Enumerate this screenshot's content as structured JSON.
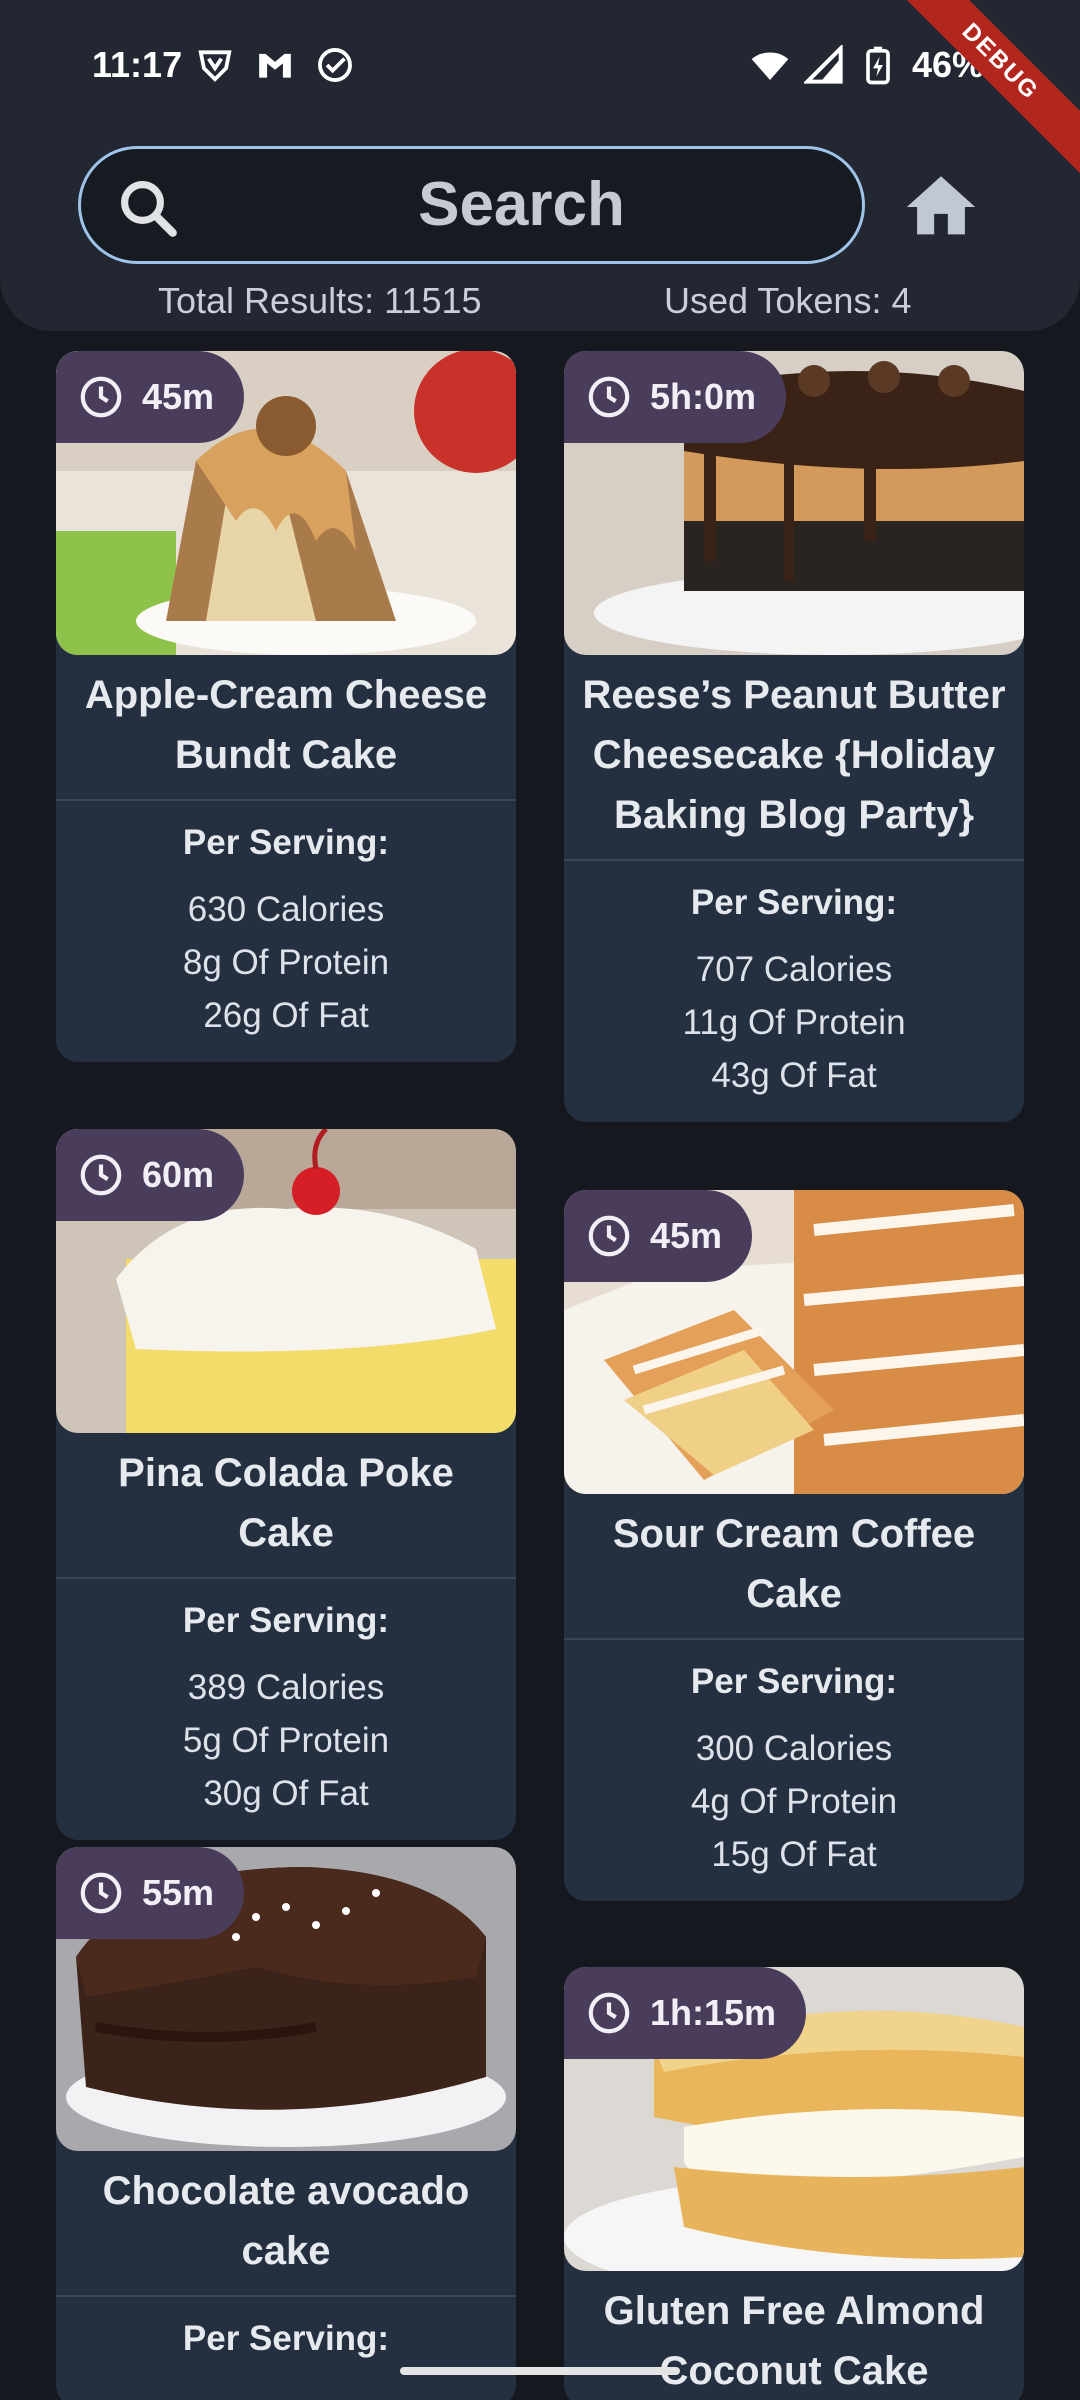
{
  "status_bar": {
    "time": "11:17",
    "battery": "46%",
    "debug_label": "DEBUG"
  },
  "search": {
    "placeholder": "Search"
  },
  "results": {
    "total": "Total Results: 11515",
    "tokens": "Used Tokens: 4"
  },
  "colors": {
    "card_bg": "#243040",
    "badge_bg": "#4a3d5c",
    "search_border": "#9fc4ea",
    "header_bg": "#222732"
  },
  "recipes": [
    {
      "time": "45m",
      "title": "Apple-Cream Cheese Bundt Cake",
      "per_serving": "Per Serving:",
      "calories": "630 Calories",
      "protein": "8g Of Protein",
      "fat": "26g Of Fat"
    },
    {
      "time": "5h:0m",
      "title": "Reese’s Peanut Butter Cheesecake {Holiday Baking Blog Party}",
      "per_serving": "Per Serving:",
      "calories": "707 Calories",
      "protein": "11g Of Protein",
      "fat": "43g Of Fat"
    },
    {
      "time": "60m",
      "title": "Pina Colada Poke Cake",
      "per_serving": "Per Serving:",
      "calories": "389 Calories",
      "protein": "5g Of Protein",
      "fat": "30g Of Fat"
    },
    {
      "time": "45m",
      "title": "Sour Cream Coffee Cake",
      "per_serving": "Per Serving:",
      "calories": "300 Calories",
      "protein": "4g Of Protein",
      "fat": "15g Of Fat"
    },
    {
      "time": "55m",
      "title": "Chocolate avocado cake",
      "per_serving": "Per Serving:"
    },
    {
      "time": "1h:15m",
      "title": "Gluten Free Almond Coconut Cake"
    }
  ]
}
